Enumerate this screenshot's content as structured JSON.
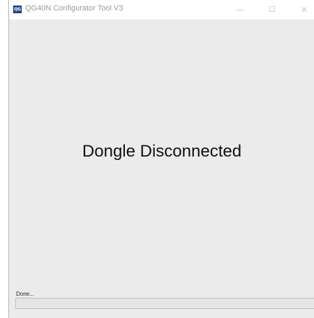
{
  "window": {
    "title": "QG40N Configurator Tool V3",
    "app_icon_text": "QG",
    "minimize_glyph": "—",
    "close_glyph": "✕"
  },
  "main": {
    "message": "Dongle Disconnected"
  },
  "status": {
    "text": "Done...",
    "progress_percent": 0
  },
  "colors": {
    "background": "#f0f0f0",
    "progress_fill": "#06b025"
  }
}
